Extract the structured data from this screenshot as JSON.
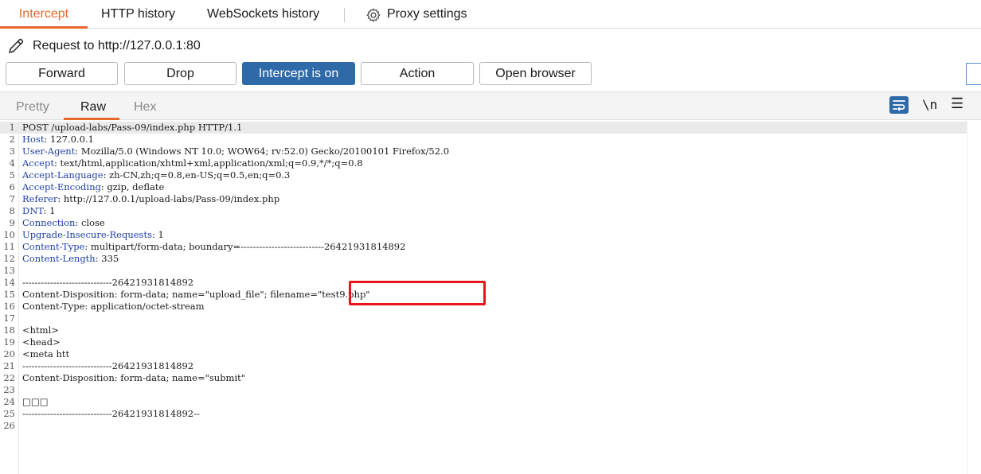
{
  "tabs": [
    {
      "label": "Intercept",
      "active": true
    },
    {
      "label": "HTTP history",
      "active": false
    },
    {
      "label": "WebSockets history",
      "active": false
    }
  ],
  "proxy_settings_label": "Proxy settings",
  "request_target": "Request to http://127.0.0.1:80",
  "toolbar": {
    "forward": "Forward",
    "drop": "Drop",
    "intercept": "Intercept is on",
    "action": "Action",
    "open_browser": "Open browser"
  },
  "view_tabs": {
    "pretty": "Pretty",
    "raw": "Raw",
    "hex": "Hex",
    "newline_toggle": "\\n"
  },
  "accent_color": "#e8672a",
  "primary_color": "#2f6aa8",
  "highlight_color": "#e8131c",
  "request_lines": [
    {
      "n": "1",
      "key": "",
      "value": "POST /upload-labs/Pass-09/index.php HTTP/1.1"
    },
    {
      "n": "2",
      "key": "Host",
      "value": " 127.0.0.1"
    },
    {
      "n": "3",
      "key": "User-Agent",
      "value": " Mozilla/5.0 (Windows NT 10.0; WOW64; rv:52.0) Gecko/20100101 Firefox/52.0"
    },
    {
      "n": "4",
      "key": "Accept",
      "value": " text/html,application/xhtml+xml,application/xml;q=0.9,*/*;q=0.8"
    },
    {
      "n": "5",
      "key": "Accept-Language",
      "value": " zh-CN,zh;q=0.8,en-US;q=0.5,en;q=0.3"
    },
    {
      "n": "6",
      "key": "Accept-Encoding",
      "value": " gzip, deflate"
    },
    {
      "n": "7",
      "key": "Referer",
      "value": " http://127.0.0.1/upload-labs/Pass-09/index.php"
    },
    {
      "n": "8",
      "key": "DNT",
      "value": " 1"
    },
    {
      "n": "9",
      "key": "Connection",
      "value": " close"
    },
    {
      "n": "10",
      "key": "Upgrade-Insecure-Requests",
      "value": " 1"
    },
    {
      "n": "11",
      "key": "Content-Type",
      "value": " multipart/form-data; boundary=---------------------------26421931814892"
    },
    {
      "n": "12",
      "key": "Content-Length",
      "value": " 335"
    },
    {
      "n": "13",
      "key": "",
      "value": ""
    },
    {
      "n": "14",
      "key": "",
      "value": "-----------------------------26421931814892"
    },
    {
      "n": "15",
      "key": "",
      "value": "Content-Disposition: form-data; name=\"upload_file\"; filename=\"test9.php\""
    },
    {
      "n": "16",
      "key": "",
      "value": "Content-Type: application/octet-stream"
    },
    {
      "n": "17",
      "key": "",
      "value": ""
    },
    {
      "n": "18",
      "key": "",
      "value": "<html>"
    },
    {
      "n": "19",
      "key": "",
      "value": "<head>"
    },
    {
      "n": "20",
      "key": "",
      "value": "<meta htt"
    },
    {
      "n": "21",
      "key": "",
      "value": "-----------------------------26421931814892"
    },
    {
      "n": "22",
      "key": "",
      "value": "Content-Disposition: form-data; name=\"submit\""
    },
    {
      "n": "23",
      "key": "",
      "value": ""
    },
    {
      "n": "24",
      "key": "",
      "value": "□□□"
    },
    {
      "n": "25",
      "key": "",
      "value": "-----------------------------26421931814892--"
    },
    {
      "n": "26",
      "key": "",
      "value": ""
    }
  ]
}
